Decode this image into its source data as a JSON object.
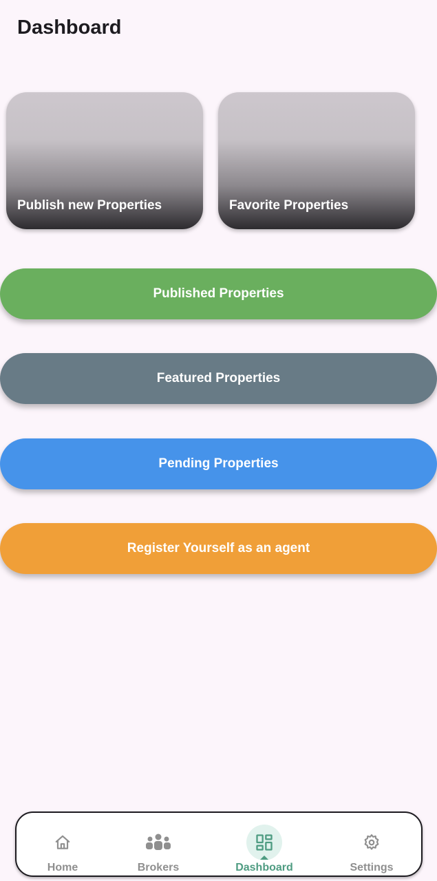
{
  "header": {
    "title": "Dashboard"
  },
  "cards": {
    "publish_label": "Publish new Properties",
    "favorite_label": "Favorite Properties"
  },
  "buttons": {
    "published": "Published Properties",
    "featured": "Featured Properties",
    "pending": "Pending Properties",
    "register": "Register Yourself as an agent"
  },
  "colors": {
    "published": "#6aaf5e",
    "featured": "#687b86",
    "pending": "#4693ea",
    "register": "#f09f38",
    "nav_active": "#4f9c82",
    "nav_inactive": "#8f8f8f"
  },
  "bottom_nav": {
    "active": "Dashboard",
    "items": [
      {
        "label": "Home",
        "icon": "home-icon"
      },
      {
        "label": "Brokers",
        "icon": "group-icon"
      },
      {
        "label": "Dashboard",
        "icon": "dashboard-icon"
      },
      {
        "label": "Settings",
        "icon": "gear-icon"
      }
    ]
  }
}
